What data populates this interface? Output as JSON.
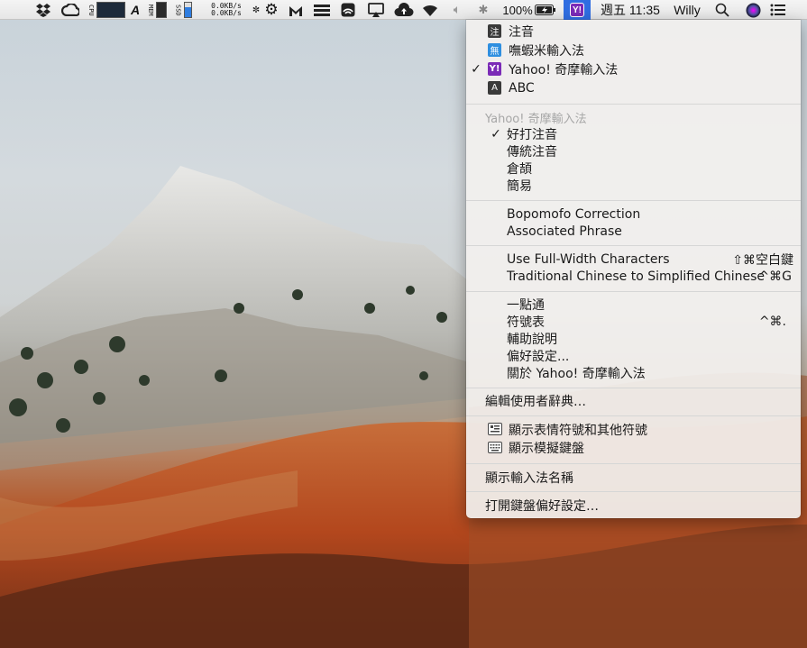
{
  "menubar": {
    "cpu_label": "CPU",
    "mem_label": "MEM",
    "ssd_label": "SSD",
    "net_up": "0.0KB/s",
    "net_down": "0.0KB/s",
    "battery_percent": "100%",
    "clock": "週五 11:35",
    "user": "Willy",
    "input_badge": "Y!",
    "icons": [
      "dropbox-icon",
      "creative-cloud-icon",
      "cpu-graph-icon",
      "font-icon",
      "mem-graph-icon",
      "ssd-graph-icon",
      "network-icon",
      "fan-icon",
      "malwarebytes-icon",
      "stack-icon",
      "airport-icon",
      "airplay-icon",
      "upload-cloud-icon",
      "wifi-icon",
      "volume-icon",
      "bluetooth-icon",
      "battery-icon",
      "yahoo-input-icon",
      "search-icon",
      "siri-icon",
      "notification-list-icon"
    ]
  },
  "menu": {
    "input_sources": [
      {
        "label": "注音",
        "icon_char": "注",
        "icon_color": "#3a3a3a",
        "checked": false
      },
      {
        "label": "嘸蝦米輸入法",
        "icon_char": "無",
        "icon_color": "#2f8fe0",
        "checked": false
      },
      {
        "label": "Yahoo! 奇摩輸入法",
        "icon_char": "Y!",
        "icon_color": "#7b2bb7",
        "checked": true
      },
      {
        "label": "ABC",
        "icon_char": "A",
        "icon_color": "#3a3a3a",
        "checked": false
      }
    ],
    "section_header": "Yahoo! 奇摩輸入法",
    "modes": [
      {
        "label": "好打注音",
        "checked": true
      },
      {
        "label": "傳統注音",
        "checked": false
      },
      {
        "label": "倉頡",
        "checked": false
      },
      {
        "label": "簡易",
        "checked": false
      }
    ],
    "options": [
      "Bopomofo Correction",
      "Associated Phrase"
    ],
    "toggles": [
      {
        "label": "Use Full-Width Characters",
        "shortcut": "⇧⌘空白鍵"
      },
      {
        "label": "Traditional Chinese to Simplified Chinese",
        "shortcut": "^⌘G"
      }
    ],
    "tools": [
      {
        "label": "一點通",
        "shortcut": ""
      },
      {
        "label": "符號表",
        "shortcut": "^⌘."
      },
      {
        "label": "輔助說明",
        "shortcut": ""
      },
      {
        "label": "偏好設定...",
        "shortcut": ""
      },
      {
        "label": "關於 Yahoo! 奇摩輸入法",
        "shortcut": ""
      }
    ],
    "edit_dictionary": "編輯使用者辭典…",
    "viewers": [
      {
        "label": "顯示表情符號和其他符號",
        "icon": "emoji-viewer-icon"
      },
      {
        "label": "顯示模擬鍵盤",
        "icon": "keyboard-viewer-icon"
      }
    ],
    "show_name": "顯示輸入法名稱",
    "open_prefs": "打開鍵盤偏好設定…"
  }
}
